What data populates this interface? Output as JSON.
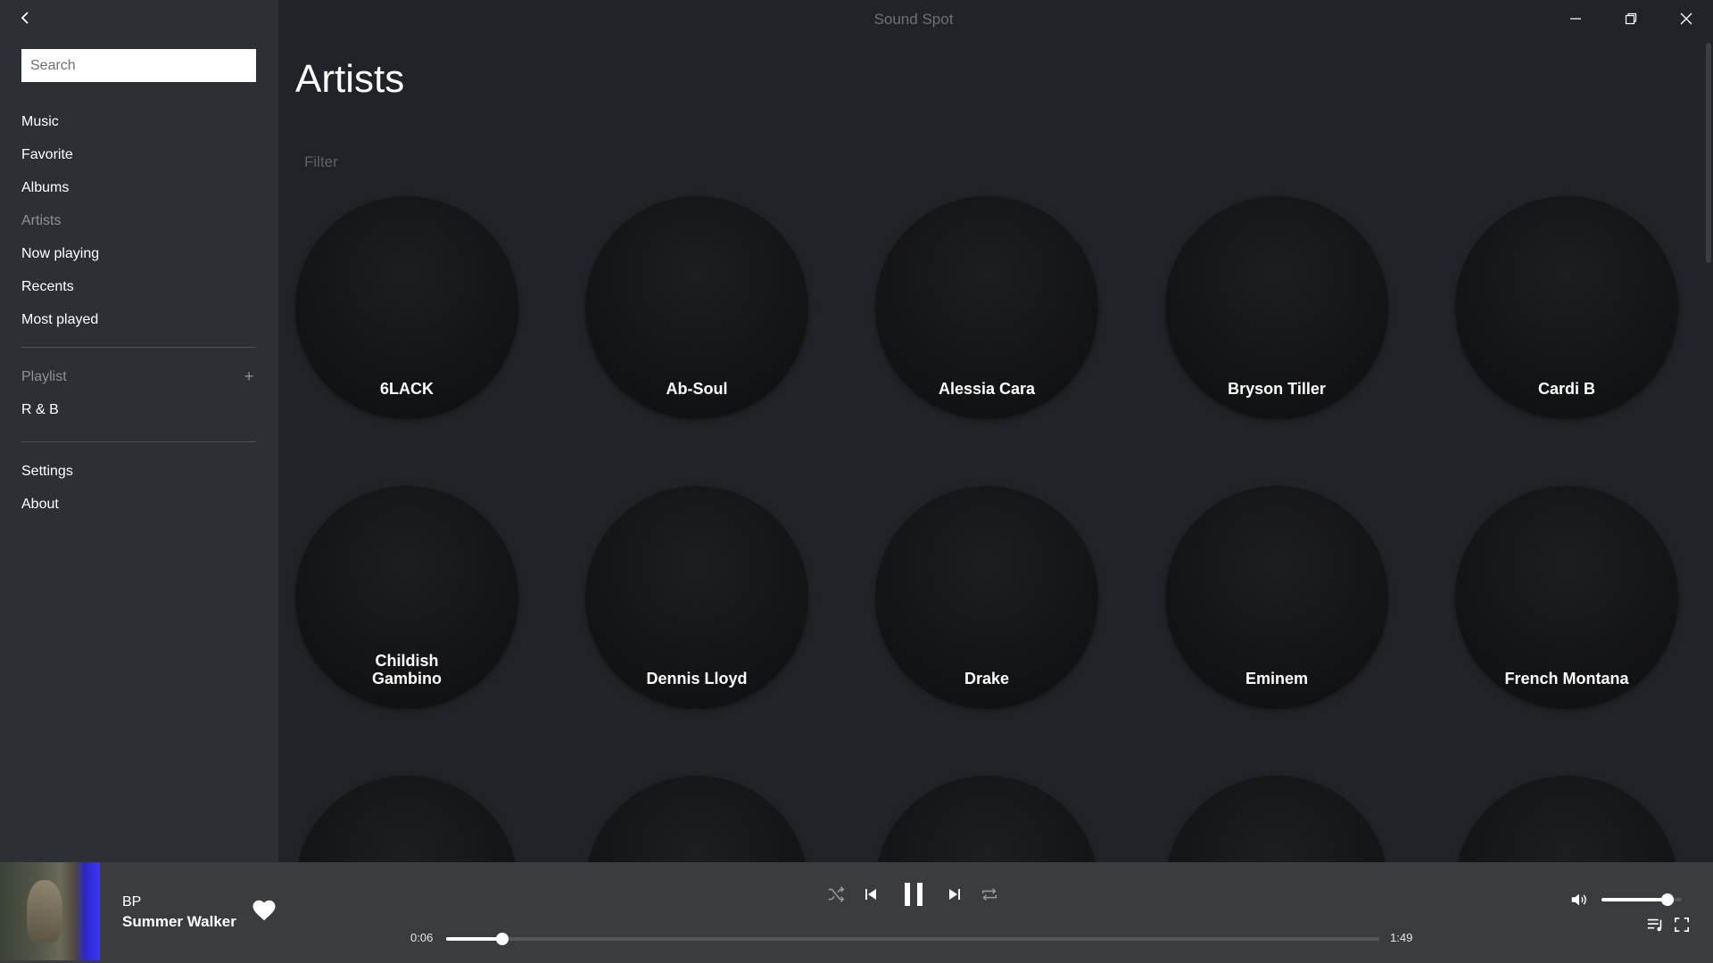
{
  "window": {
    "title": "Sound Spot",
    "controls": [
      "minimize",
      "restore",
      "close"
    ]
  },
  "sidebar": {
    "search_placeholder": "Search",
    "nav": [
      {
        "label": "Music",
        "active": false
      },
      {
        "label": "Favorite",
        "active": false
      },
      {
        "label": "Albums",
        "active": false
      },
      {
        "label": "Artists",
        "active": true
      },
      {
        "label": "Now playing",
        "active": false
      },
      {
        "label": "Recents",
        "active": false
      },
      {
        "label": "Most played",
        "active": false
      }
    ],
    "playlist_header": "Playlist",
    "playlist_add": "+",
    "playlists": [
      {
        "label": "R & B"
      }
    ],
    "bottom_nav": [
      {
        "label": "Settings"
      },
      {
        "label": "About"
      }
    ]
  },
  "main": {
    "title": "Artists",
    "filter_placeholder": "Filter",
    "artists": [
      {
        "name": "6LACK"
      },
      {
        "name": "Ab-Soul"
      },
      {
        "name": "Alessia Cara"
      },
      {
        "name": "Bryson Tiller"
      },
      {
        "name": "Cardi B"
      },
      {
        "name": "Childish Gambino"
      },
      {
        "name": "Dennis Lloyd"
      },
      {
        "name": "Drake"
      },
      {
        "name": "Eminem"
      },
      {
        "name": "French Montana"
      },
      {
        "name": ""
      },
      {
        "name": ""
      },
      {
        "name": ""
      },
      {
        "name": ""
      },
      {
        "name": ""
      }
    ]
  },
  "player": {
    "track_title": "BP",
    "track_artist": "Summer Walker",
    "elapsed": "0:06",
    "duration": "1:49",
    "progress_fraction": 0.06,
    "volume_fraction": 0.82,
    "favorited": true,
    "state": "playing",
    "icons": [
      "shuffle-icon",
      "previous-icon",
      "pause-icon",
      "next-icon",
      "repeat-icon",
      "volume-icon",
      "queue-icon",
      "fullscreen-icon"
    ]
  },
  "colors": {
    "background": "#202327",
    "sidebar": "#2c2f33",
    "player": "#3a3c40",
    "muted_text": "#8e9196"
  }
}
